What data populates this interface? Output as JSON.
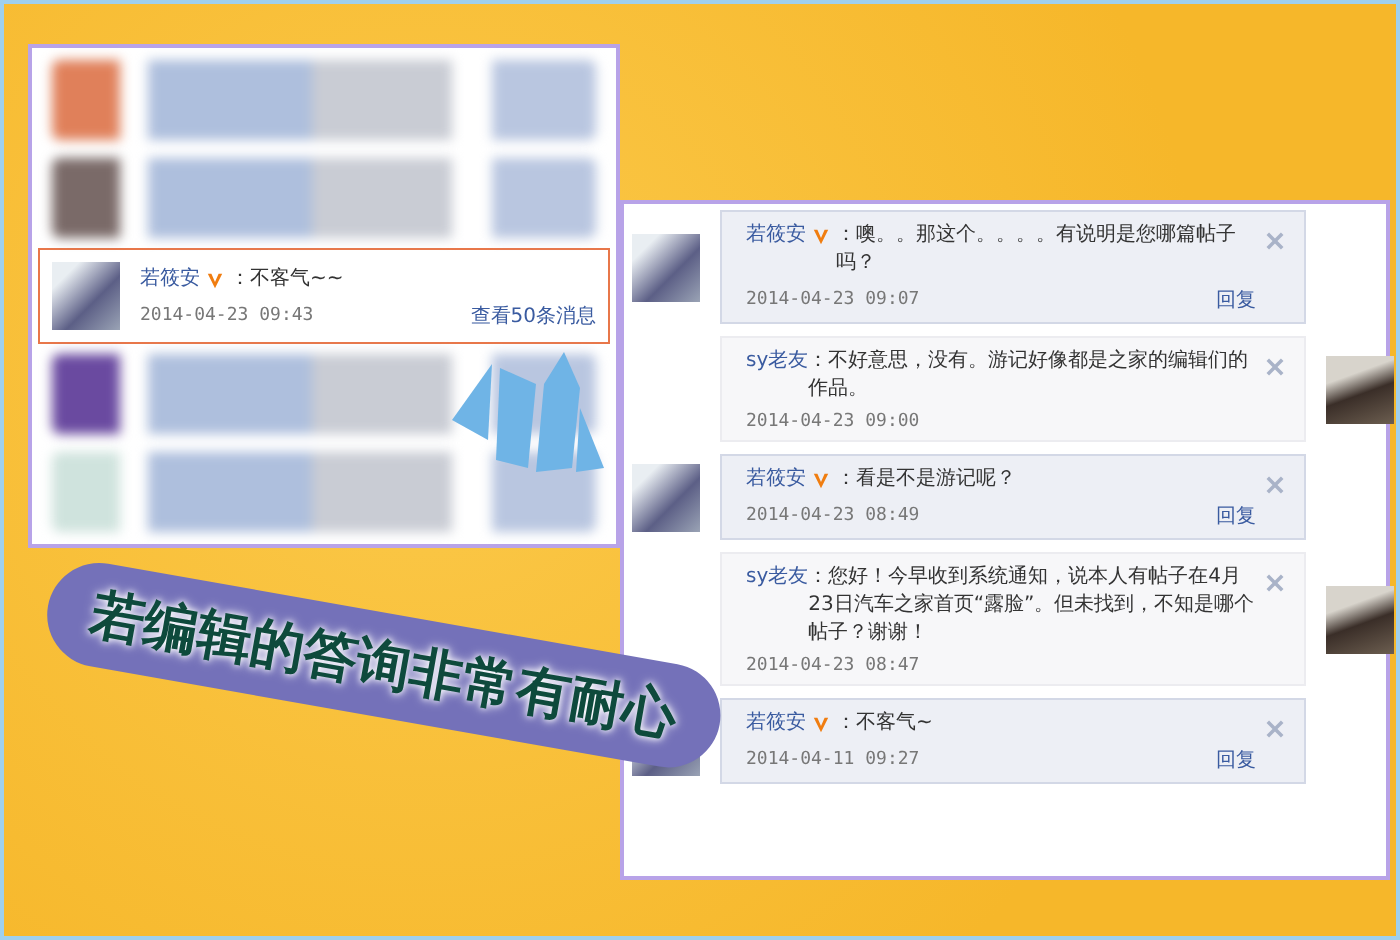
{
  "left_panel": {
    "rows": [
      {
        "kind": "blurred"
      },
      {
        "kind": "blurred"
      },
      {
        "kind": "highlighted",
        "name": "若筱安",
        "verified": true,
        "text": "：不客气~~",
        "date": "2014-04-23 09:43",
        "link": "查看50条消息"
      },
      {
        "kind": "blurred"
      },
      {
        "kind": "blurred"
      }
    ]
  },
  "conversation": {
    "messages": [
      {
        "kind": "incoming",
        "name": "若筱安",
        "verified": true,
        "text": "：噢。。那这个。。。。有说明是您哪篇帖子吗？",
        "date": "2014-04-23 09:07",
        "reply": "回复"
      },
      {
        "kind": "outgoing",
        "name": "sy老友",
        "verified": false,
        "text": "：不好意思，没有。游记好像都是之家的编辑们的作品。",
        "date": "2014-04-23 09:00"
      },
      {
        "kind": "incoming",
        "name": "若筱安",
        "verified": true,
        "text": "：看是不是游记呢？",
        "date": "2014-04-23 08:49",
        "reply": "回复"
      },
      {
        "kind": "outgoing",
        "name": "sy老友",
        "verified": false,
        "text": "：您好！今早收到系统通知，说本人有帖子在4月23日汽车之家首页“露脸”。但未找到，不知是哪个帖子？谢谢！",
        "date": "2014-04-23 08:47"
      },
      {
        "kind": "incoming",
        "name": "若筱安",
        "verified": true,
        "text": "：不客气~",
        "date": "2014-04-11 09:27",
        "reply": "回复"
      }
    ]
  },
  "caption": "若编辑的答询非常有耐心"
}
